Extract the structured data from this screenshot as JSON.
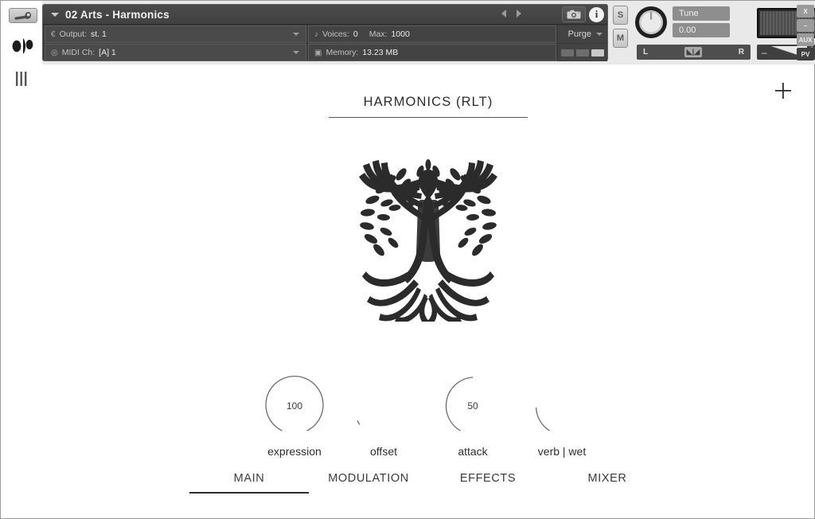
{
  "sidebar": {
    "wrench_icon": "wrench-icon",
    "logo_icon": "kontakt-logo-icon",
    "bars_icon": "vertical-bars-icon"
  },
  "rack": {
    "instrument": {
      "name": "02 Arts - Harmonics",
      "expand_icon": "chevron-down-icon",
      "prev_icon": "prev-arrow-icon",
      "next_icon": "next-arrow-icon",
      "snapshot_icon": "camera-icon",
      "info_icon": "info-icon",
      "info_glyph": "i",
      "output_icon": "output-icon",
      "output_label": "Output:",
      "output_value": "st. 1",
      "midi_icon": "midi-icon",
      "midi_label": "MIDI Ch:",
      "midi_value": "[A] 1",
      "voices_icon": "voices-icon",
      "voices_label": "Voices:",
      "voices_value": "0",
      "voices_max_label": "Max:",
      "voices_max_value": "1000",
      "memory_icon": "memory-icon",
      "memory_label": "Memory:",
      "memory_value": "13.23 MB",
      "purge_label": "Purge",
      "purge_caret": "chevron-down-icon"
    },
    "mixer": {
      "solo_label": "S",
      "mute_label": "M",
      "tune_label": "Tune",
      "tune_value": "0.00",
      "pan_left_label": "L",
      "pan_right_label": "R",
      "pan_center_icon": "pan-center-icon",
      "volume_minus": "–",
      "volume_plus": "+",
      "tune_knob_icon": "tune-knob-icon",
      "meter_icon": "level-meter-icon"
    },
    "panel_buttons": [
      {
        "label": "X",
        "name": "close-button",
        "dark": false
      },
      {
        "label": "–",
        "name": "minimize-button",
        "dark": false
      },
      {
        "label": "AUX",
        "name": "aux-button",
        "dark": false
      },
      {
        "label": "PV",
        "name": "pv-button",
        "dark": true
      }
    ]
  },
  "gui": {
    "title": "HARMONICS (RLT)",
    "add_icon": "plus-icon",
    "logo_icon": "tree-of-life-icon",
    "knobs": [
      {
        "label": "expression",
        "value": "100",
        "percent": 100
      },
      {
        "label": "offset",
        "value": "",
        "percent": 0
      },
      {
        "label": "attack",
        "value": "50",
        "percent": 50
      },
      {
        "label": "verb | wet",
        "value": "",
        "percent": 13
      }
    ],
    "tabs": [
      {
        "label": "MAIN",
        "active": true
      },
      {
        "label": "MODULATION",
        "active": false
      },
      {
        "label": "EFFECTS",
        "active": false
      },
      {
        "label": "MIXER",
        "active": false
      }
    ]
  },
  "colors": {
    "rack_bg": "#e9e9e9",
    "panel_dark": "#3a3a3a",
    "gui_bg": "#ffffff",
    "text_dark": "#2b2b2b",
    "arc": "#6d6d6d"
  }
}
